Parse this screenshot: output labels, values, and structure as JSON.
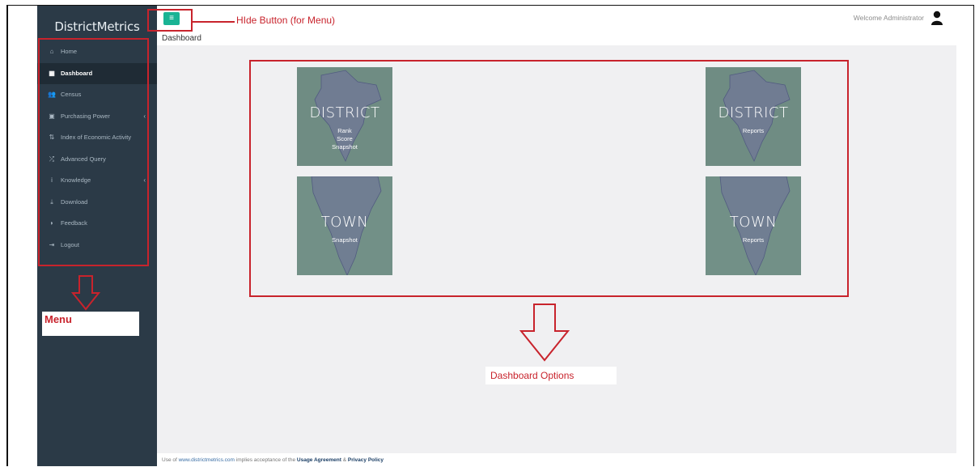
{
  "brand": "DistrictMetrics",
  "breadcrumb": "Dashboard",
  "header": {
    "welcome": "Welcome Administrator",
    "hide_button_glyph": "≡",
    "user_icon": "user-icon"
  },
  "sidebar": {
    "items": [
      {
        "label": "Home",
        "icon": "home-icon",
        "glyph": "⌂",
        "active": false,
        "chevron": false
      },
      {
        "label": "Dashboard",
        "icon": "grid-icon",
        "glyph": "▦",
        "active": true,
        "chevron": false
      },
      {
        "label": "Census",
        "icon": "users-icon",
        "glyph": "👥",
        "active": false,
        "chevron": false
      },
      {
        "label": "Purchasing Power",
        "icon": "money-icon",
        "glyph": "▣",
        "active": false,
        "chevron": true
      },
      {
        "label": "Index of Economic Activity",
        "icon": "sort-icon",
        "glyph": "⇅",
        "active": false,
        "chevron": false
      },
      {
        "label": "Advanced Query",
        "icon": "shuffle-icon",
        "glyph": "⤮",
        "active": false,
        "chevron": false
      },
      {
        "label": "Knowledge",
        "icon": "info-icon",
        "glyph": "i",
        "active": false,
        "chevron": true
      },
      {
        "label": "Download",
        "icon": "download-icon",
        "glyph": "⤓",
        "active": false,
        "chevron": false
      },
      {
        "label": "Feedback",
        "icon": "rss-icon",
        "glyph": "◗",
        "active": false,
        "chevron": false
      },
      {
        "label": "Logout",
        "icon": "logout-icon",
        "glyph": "⇥",
        "active": false,
        "chevron": false
      }
    ],
    "chevron_glyph": "‹"
  },
  "tiles": {
    "district_snapshot": {
      "title": "DISTRICT",
      "lines": [
        "Rank",
        "Score",
        "Snapshot"
      ]
    },
    "district_reports": {
      "title": "DISTRICT",
      "lines": [
        "Reports"
      ]
    },
    "town_snapshot": {
      "title": "TOWN",
      "lines": [
        "Snapshot"
      ]
    },
    "town_reports": {
      "title": "TOWN",
      "lines": [
        "Reports"
      ]
    }
  },
  "annotations": {
    "hide_button": "HIde Button (for Menu)",
    "menu": "Menu",
    "dashboard_options": "Dashboard Options"
  },
  "footer": {
    "prefix": "Use of ",
    "site": "www.districtmetrics.com",
    "middle": " implies acceptance of the ",
    "usage": "Usage Agreement",
    "amp": " & ",
    "privacy": "Privacy Policy"
  },
  "colors": {
    "sidebar_bg": "#2b3a47",
    "accent_green": "#1ab394",
    "annotation_red": "#c8232c",
    "content_bg": "#f0f0f2"
  }
}
